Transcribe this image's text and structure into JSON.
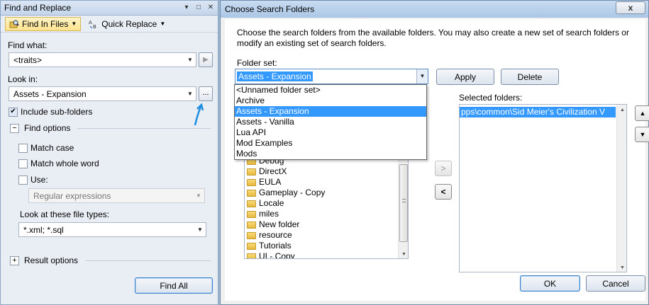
{
  "find_panel": {
    "title": "Find and Replace",
    "title_buttons": [
      "▾",
      "□",
      "✕"
    ],
    "modes": [
      {
        "label": "Find In Files",
        "icon": "find-in-files-icon",
        "active": true
      },
      {
        "label": "Quick Replace",
        "icon": "quick-replace-icon",
        "active": false
      }
    ],
    "find_what_label": "Find what:",
    "find_what_value": "<traits>",
    "look_in_label": "Look in:",
    "look_in_value": "Assets - Expansion",
    "browse_label": "...",
    "include_subfolders_label": "Include sub-folders",
    "include_subfolders_checked": true,
    "find_options_label": "Find options",
    "match_case_label": "Match case",
    "match_whole_word_label": "Match whole word",
    "use_label": "Use:",
    "use_value": "Regular expressions",
    "file_types_label": "Look at these file types:",
    "file_types_value": "*.xml; *.sql",
    "result_options_label": "Result options",
    "find_all_label": "Find All",
    "annotation_color": "#1e8fe0"
  },
  "dialog": {
    "title": "Choose Search Folders",
    "close_label": "x",
    "description": "Choose the search folders from the available folders. You may also create a new set of search folders or modify an existing set of search folders.",
    "folder_set_label": "Folder set:",
    "folder_set_value": "Assets - Expansion",
    "apply_label": "Apply",
    "delete_label": "Delete",
    "folder_set_options": [
      "<Unnamed folder set>",
      "Archive",
      "Assets - Expansion",
      "Assets - Vanilla",
      "Lua API",
      "Mod Examples",
      "Mods"
    ],
    "folder_set_selected_index": 2,
    "available_folders": [
      "Debug",
      "DirectX",
      "EULA",
      "Gameplay - Copy",
      "Locale",
      "miles",
      "New folder",
      "resource",
      "Tutorials",
      "UI - Copy"
    ],
    "selected_folders_label": "Selected folders:",
    "selected_folders": [
      "pps\\common\\Sid Meier's Civilization V"
    ],
    "add_arrow": ">",
    "remove_arrow": "<",
    "move_up": "▲",
    "move_down": "▼",
    "ok_label": "OK",
    "cancel_label": "Cancel",
    "selection_color": "#3399ff"
  }
}
